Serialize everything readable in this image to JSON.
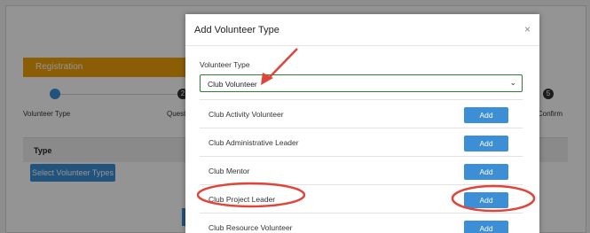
{
  "background": {
    "registration_label": "Registration",
    "steps": [
      {
        "marker": "",
        "label": "Volunteer Type"
      },
      {
        "marker": "2",
        "label": "Questi"
      },
      {
        "marker": "5",
        "label": "Confirm"
      }
    ],
    "type_header": "Type",
    "select_types_button": "Select Volunteer Types"
  },
  "modal": {
    "title": "Add Volunteer Type",
    "close_symbol": "×",
    "field_label": "Volunteer Type",
    "select_value": "Club Volunteer",
    "select_caret": "⌄",
    "rows": [
      {
        "label": "Club Activity Volunteer",
        "button": "Add"
      },
      {
        "label": "Club Administrative Leader",
        "button": "Add"
      },
      {
        "label": "Club Mentor",
        "button": "Add"
      },
      {
        "label": "Club Project Leader",
        "button": "Add"
      },
      {
        "label": "Club Resource Volunteer",
        "button": "Add"
      }
    ]
  },
  "colors": {
    "accent_blue": "#3c8fd6",
    "registration_orange": "#f0a30a",
    "annotation_red": "#e0453a"
  }
}
